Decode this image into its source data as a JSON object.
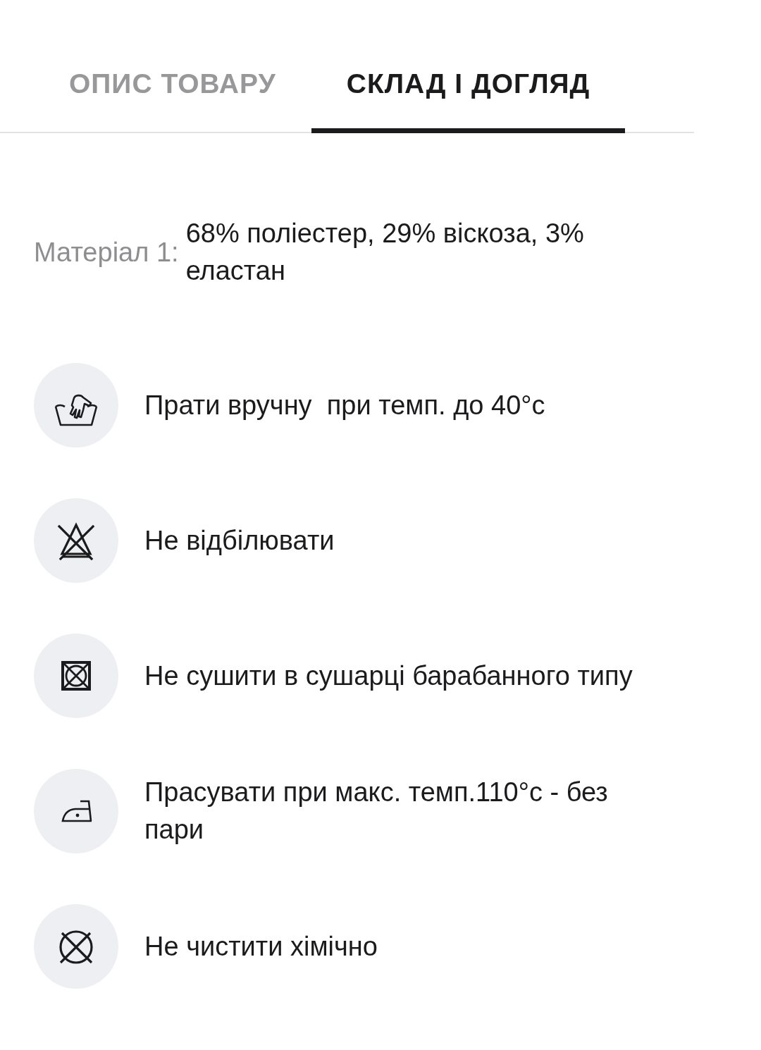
{
  "tabs": [
    {
      "label": "ОПИС ТОВАРУ",
      "selected": false
    },
    {
      "label": "СКЛАД І ДОГЛЯД",
      "selected": true
    }
  ],
  "composition": [
    {
      "label": "Матеріал 1:",
      "value": "68% поліестер, 29% віскоза, 3% еластан"
    }
  ],
  "care": [
    {
      "kind": "hand-wash",
      "text": "Прати вручну  при темп. до 40°c"
    },
    {
      "kind": "no-bleach",
      "text": "Не відбілювати"
    },
    {
      "kind": "no-tumble-dry",
      "text": "Не сушити в сушарці барабанного типу"
    },
    {
      "kind": "iron",
      "text": "Прасувати при макс. темп.110°c - без пари"
    },
    {
      "kind": "no-dry-clean",
      "text": "Не чистити хімічно"
    }
  ]
}
